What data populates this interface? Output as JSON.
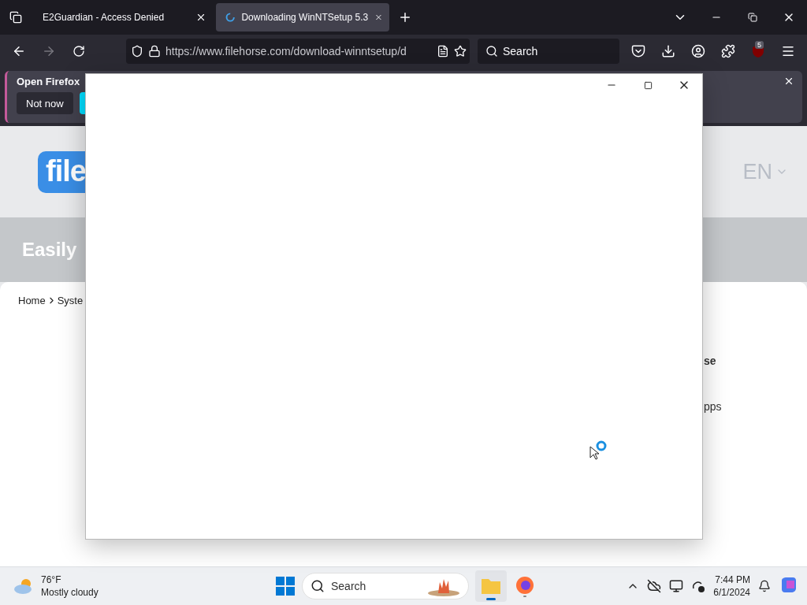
{
  "tabs": [
    {
      "label": "E2Guardian - Access Denied",
      "selected": false
    },
    {
      "label": "Downloading WinNTSetup 5.3",
      "selected": true
    }
  ],
  "address_bar": {
    "url": "https://www.filehorse.com/download-winntsetup/d"
  },
  "search": {
    "placeholder": "Search"
  },
  "extension_badge": "5",
  "notification": {
    "message": "Open Firefox",
    "button": "Not now"
  },
  "page": {
    "logo": "file",
    "language": "EN",
    "banner": "Easily",
    "breadcrumb": [
      "Home",
      "Syste"
    ],
    "side_texts": [
      "se",
      "pps"
    ]
  },
  "taskbar": {
    "temperature": "76°F",
    "weather": "Mostly cloudy",
    "search": "Search",
    "time": "7:44 PM",
    "date": "6/1/2024"
  }
}
